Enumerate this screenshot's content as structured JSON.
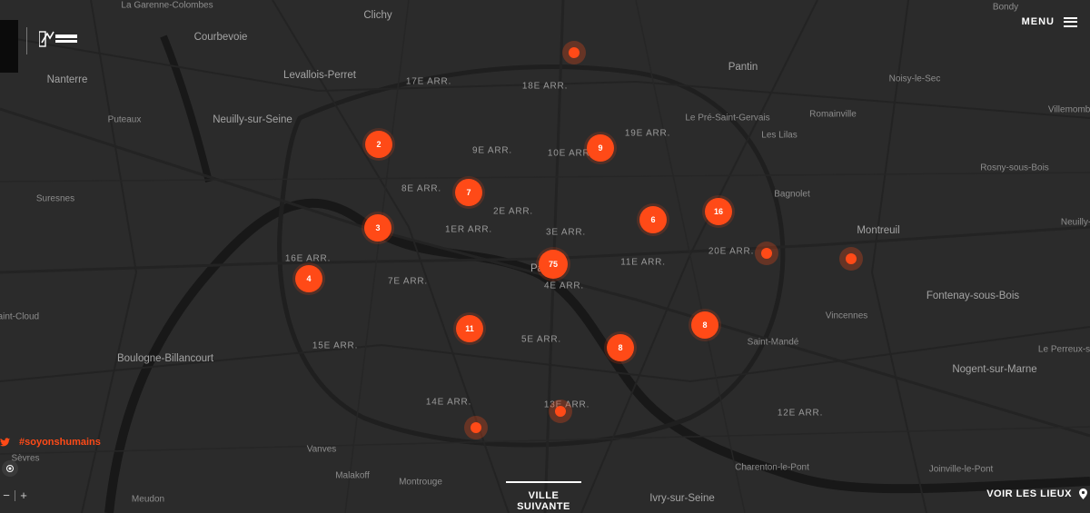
{
  "map": {
    "places": [
      {
        "label": "La Garenne-Colombes",
        "type": "small"
      },
      {
        "label": "Clichy",
        "type": "big"
      },
      {
        "label": "Courbevoie",
        "type": "big"
      },
      {
        "label": "Levallois-Perret",
        "type": "big"
      },
      {
        "label": "17E ARR.",
        "type": "arr"
      },
      {
        "label": "18E ARR.",
        "type": "arr"
      },
      {
        "label": "Pantin",
        "type": "big"
      },
      {
        "label": "Noisy-le-Sec",
        "type": "small"
      },
      {
        "label": "Nanterre",
        "type": "big"
      },
      {
        "label": "Neuilly-sur-Seine",
        "type": "big"
      },
      {
        "label": "Puteaux",
        "type": "small"
      },
      {
        "label": "Le Pré-Saint-Gervais",
        "type": "small"
      },
      {
        "label": "Romainville",
        "type": "small"
      },
      {
        "label": "19E ARR.",
        "type": "arr"
      },
      {
        "label": "Les Lilas",
        "type": "small"
      },
      {
        "label": "9E ARR.",
        "type": "arr"
      },
      {
        "label": "10E ARR.",
        "type": "arr"
      },
      {
        "label": "8E ARR.",
        "type": "arr"
      },
      {
        "label": "Bagnolet",
        "type": "small"
      },
      {
        "label": "Suresnes",
        "type": "small"
      },
      {
        "label": "2E ARR.",
        "type": "arr"
      },
      {
        "label": "1ER ARR.",
        "type": "arr"
      },
      {
        "label": "3E ARR.",
        "type": "arr"
      },
      {
        "label": "Montreuil",
        "type": "big"
      },
      {
        "label": "20E ARR.",
        "type": "arr"
      },
      {
        "label": "16E ARR.",
        "type": "arr"
      },
      {
        "label": "11E ARR.",
        "type": "arr"
      },
      {
        "label": "Pa",
        "type": "big"
      },
      {
        "label": "7E ARR.",
        "type": "arr"
      },
      {
        "label": "4E ARR.",
        "type": "arr"
      },
      {
        "label": "Fontenay-sous-Bois",
        "type": "big"
      },
      {
        "label": "Saint-Cloud",
        "type": "small"
      },
      {
        "label": "Vincennes",
        "type": "small"
      },
      {
        "label": "5E ARR.",
        "type": "arr"
      },
      {
        "label": "Saint-Mandé",
        "type": "small"
      },
      {
        "label": "15E ARR.",
        "type": "arr"
      },
      {
        "label": "Boulogne-Billancourt",
        "type": "big"
      },
      {
        "label": "Nogent-sur-Marne",
        "type": "big"
      },
      {
        "label": "14E ARR.",
        "type": "arr"
      },
      {
        "label": "13E ARR.",
        "type": "arr"
      },
      {
        "label": "12E ARR.",
        "type": "arr"
      },
      {
        "label": "Vanves",
        "type": "small"
      },
      {
        "label": "Sèvres",
        "type": "small"
      },
      {
        "label": "Malakoff",
        "type": "small"
      },
      {
        "label": "Montrouge",
        "type": "small"
      },
      {
        "label": "Charenton-le-Pont",
        "type": "small"
      },
      {
        "label": "Joinville-le-Pont",
        "type": "small"
      },
      {
        "label": "Meudon",
        "type": "small"
      },
      {
        "label": "Ivry-sur-Seine",
        "type": "big"
      },
      {
        "label": "Bondy",
        "type": "small"
      },
      {
        "label": "Villemomble",
        "type": "small"
      },
      {
        "label": "Rosny-sous-Bois",
        "type": "small"
      },
      {
        "label": "Neuilly-Pl",
        "type": "small"
      },
      {
        "label": "Le Perreux-sur",
        "type": "small"
      }
    ],
    "clusters": [
      {
        "count": "2"
      },
      {
        "count": "9"
      },
      {
        "count": "7"
      },
      {
        "count": "6"
      },
      {
        "count": "16"
      },
      {
        "count": "3"
      },
      {
        "count": "75"
      },
      {
        "count": "4"
      },
      {
        "count": "11"
      },
      {
        "count": "8"
      },
      {
        "count": "8"
      }
    ],
    "single_markers": 5
  },
  "header": {
    "menu_label": "MENU",
    "logo_partner": "Emmaüs Solidarité"
  },
  "social": {
    "icon": "twitter-icon",
    "hashtag": "#soyonshumains"
  },
  "controls": {
    "zoom_out": "−",
    "zoom_in": "+"
  },
  "footer": {
    "next_city": "VILLE SUIVANTE",
    "see_places": "VOIR LES LIEUX"
  },
  "colors": {
    "accent": "#ff4a17",
    "map_bg": "#2b2b2b",
    "road": "#1e1e1e",
    "river": "#181818"
  }
}
